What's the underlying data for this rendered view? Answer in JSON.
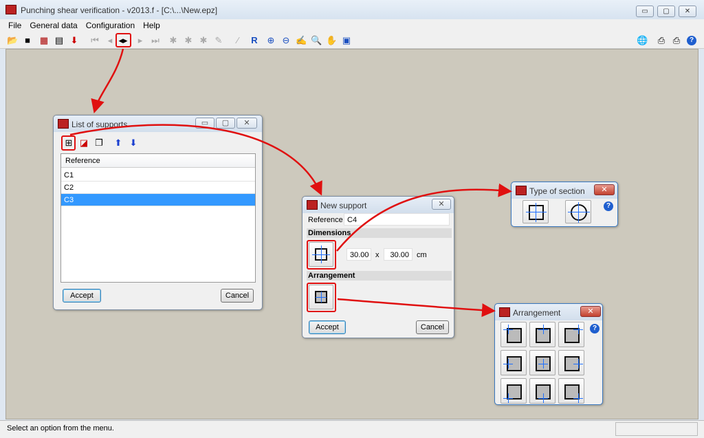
{
  "window": {
    "title": "Punching shear verification - v2013.f - [C:\\...\\New.epz]",
    "min": "▭",
    "max": "▢",
    "close": "✕"
  },
  "menu": [
    "File",
    "General data",
    "Configuration",
    "Help"
  ],
  "toolbar": {
    "icons": [
      "open-icon",
      "save-icon",
      "wall-icon",
      "export-icon",
      "import-icon",
      "first-icon",
      "prev-icon",
      "supports-list-icon",
      "next-icon",
      "last-icon"
    ]
  },
  "status": {
    "text": "Select an option from the menu."
  },
  "list_dialog": {
    "title": "List of supports",
    "column": "Reference",
    "rows": [
      "C1",
      "C2",
      "C3"
    ],
    "selected": "C3",
    "accept": "Accept",
    "cancel": "Cancel"
  },
  "new_support": {
    "title": "New support",
    "reference_label": "Reference",
    "reference_value": "C4",
    "dimensions_label": "Dimensions",
    "dim_x": "30.00",
    "times": "x",
    "dim_y": "30.00",
    "unit": "cm",
    "arrangement_label": "Arrangement",
    "accept": "Accept",
    "cancel": "Cancel"
  },
  "type_section": {
    "title": "Type of section",
    "help": "?"
  },
  "arrangement": {
    "title": "Arrangement",
    "help": "?"
  },
  "colors": {
    "workspace": "#cdc9bd",
    "annotation": "#e01010",
    "selection": "#3399ff"
  }
}
